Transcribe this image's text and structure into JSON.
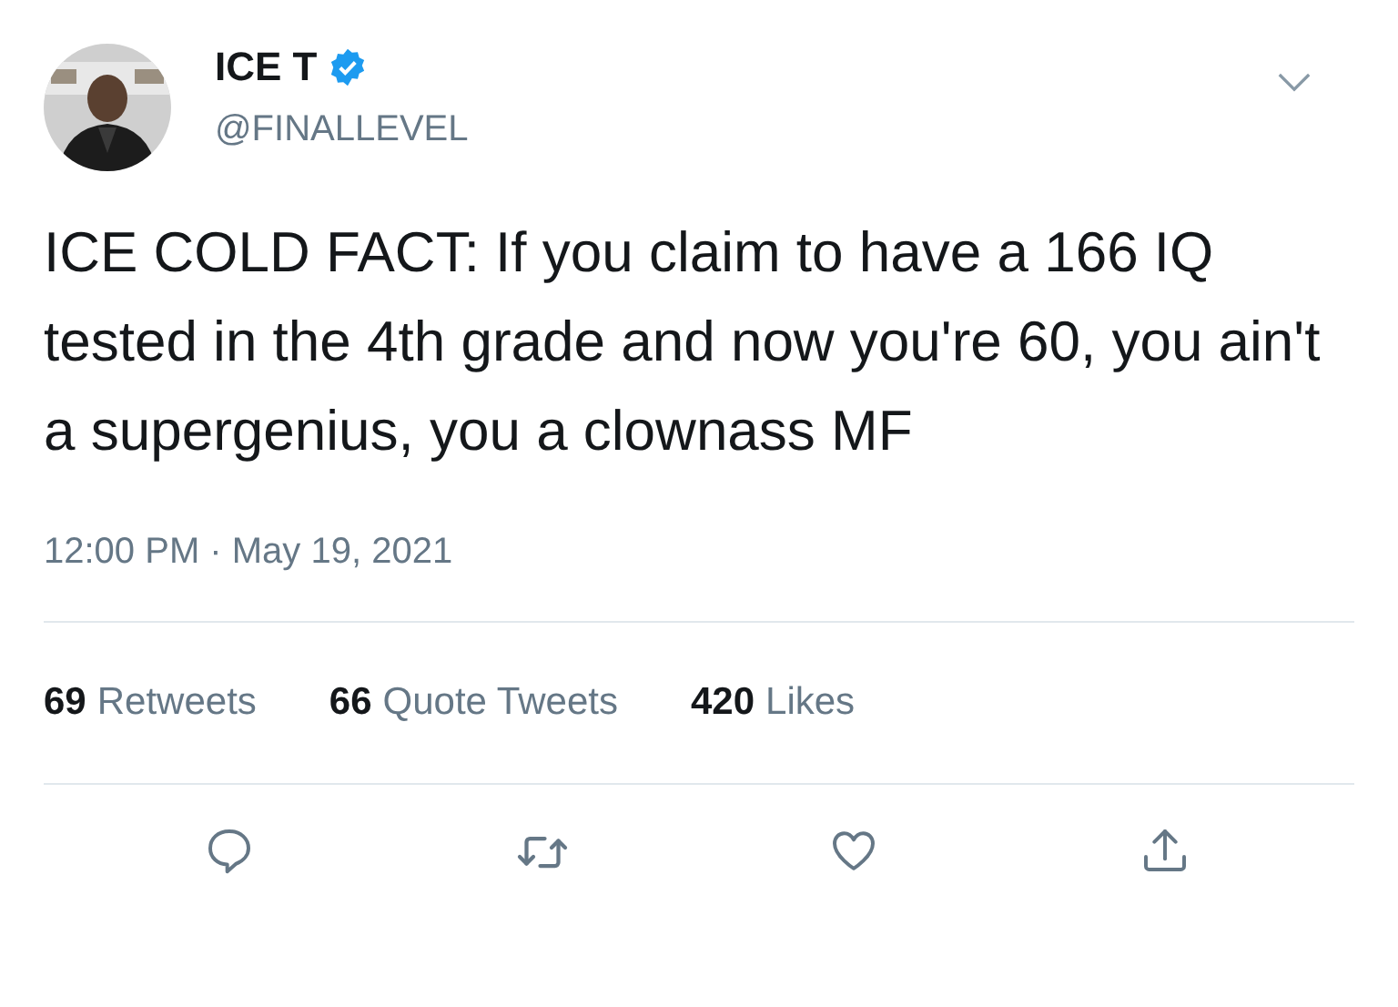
{
  "author": {
    "name": "ICE T",
    "verified": true,
    "handle": "@FINALLEVEL"
  },
  "text": "ICE COLD FACT: If you claim to have a 166 IQ tested in the 4th grade and now you're 60, you ain't a supergenius, you a clownass MF",
  "timestamp": "12:00 PM · May 19, 2021",
  "stats": [
    {
      "count": "69",
      "label": "Retweets"
    },
    {
      "count": "66",
      "label": "Quote Tweets"
    },
    {
      "count": "420",
      "label": "Likes"
    }
  ],
  "actions": [
    {
      "kind": "reply"
    },
    {
      "kind": "retweet"
    },
    {
      "kind": "like"
    },
    {
      "kind": "share"
    }
  ]
}
